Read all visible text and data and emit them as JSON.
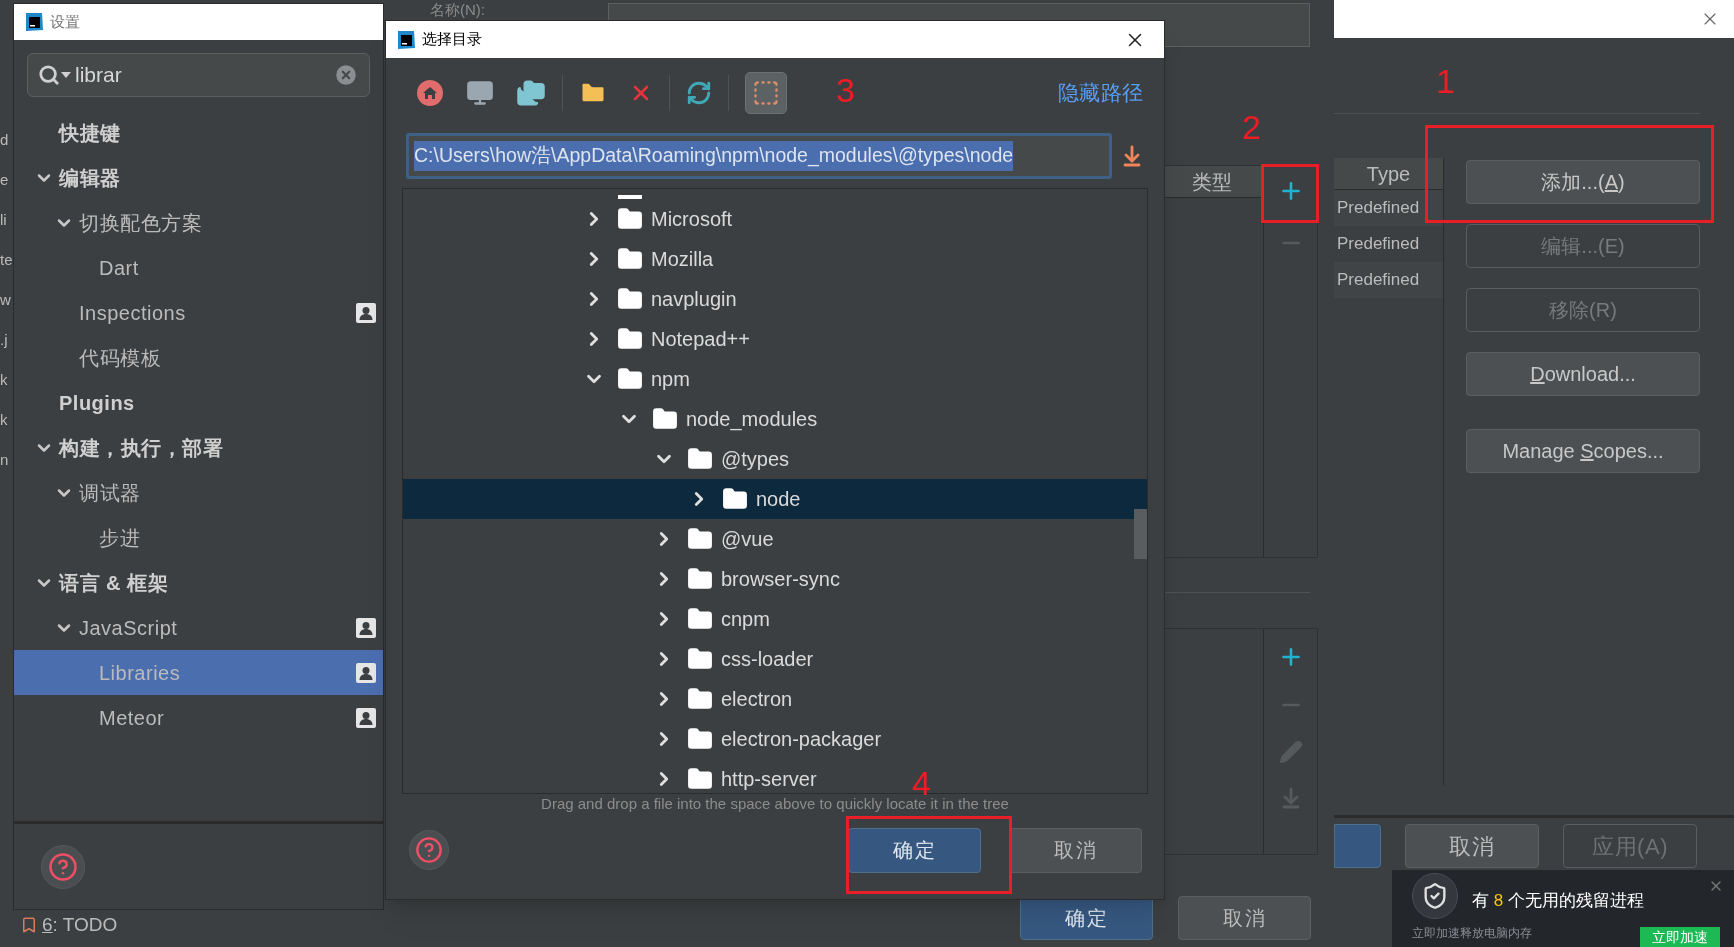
{
  "ide_background": {
    "editor_fragments": [
      "d",
      "e",
      "li",
      "te",
      "w",
      ".j",
      "k",
      "k",
      "n"
    ],
    "tool_window_tab": {
      "number": "6",
      "label": ": TODO"
    }
  },
  "settings_window": {
    "title": "设置",
    "search": {
      "value": "librar"
    },
    "tree": [
      {
        "label": "快捷键",
        "selected": false,
        "badge": false
      },
      {
        "label": "编辑器",
        "expanded": true,
        "selected": false,
        "badge": false,
        "children": [
          {
            "label": "切换配色方案",
            "expanded": true,
            "selected": false,
            "badge": false,
            "children": [
              {
                "label": "Dart",
                "selected": false,
                "badge": false
              }
            ]
          },
          {
            "label": "Inspections",
            "selected": false,
            "badge": true
          },
          {
            "label": "代码模板",
            "selected": false,
            "badge": false
          }
        ]
      },
      {
        "label": "Plugins",
        "selected": false,
        "badge": false
      },
      {
        "label": "构建，执行，部署",
        "expanded": true,
        "selected": false,
        "badge": false,
        "children": [
          {
            "label": "调试器",
            "expanded": true,
            "selected": false,
            "badge": false,
            "children": [
              {
                "label": "步进",
                "selected": false,
                "badge": false
              }
            ]
          }
        ]
      },
      {
        "label": "语言 & 框架",
        "expanded": true,
        "selected": false,
        "badge": false,
        "children": [
          {
            "label": "JavaScript",
            "expanded": true,
            "selected": false,
            "badge": true,
            "children": [
              {
                "label": "Libraries",
                "selected": true,
                "badge": true
              },
              {
                "label": "Meteor",
                "selected": false,
                "badge": true
              }
            ]
          }
        ]
      }
    ]
  },
  "library_dialog": {
    "name_label": "名称(N):",
    "table": {
      "column": "类型"
    },
    "buttons": [
      {
        "label": "确定",
        "primary": true
      },
      {
        "label": "取消",
        "primary": false
      }
    ]
  },
  "libraries_dialog": {
    "table": {
      "column": "Type",
      "rows": [
        "Predefined",
        "Predefined",
        "Predefined"
      ]
    },
    "side_buttons": [
      {
        "before": "添加...(",
        "mnemonic": "A",
        "after": ")",
        "disabled": false
      },
      {
        "label": "编辑...(E)",
        "disabled": true
      },
      {
        "label": "移除(R)",
        "disabled": true
      },
      {
        "mnemonic": "D",
        "after": "ownload...",
        "disabled": false
      },
      {
        "before": "Manage ",
        "mnemonic": "S",
        "after": "copes...",
        "disabled": false
      }
    ],
    "buttons": [
      {
        "label": "取消",
        "disabled": false
      },
      {
        "label": "应用(A)",
        "disabled": true
      }
    ]
  },
  "choose_directory_dialog": {
    "title": "选择目录",
    "toggle_path_label": "隐藏路径",
    "path": {
      "value": "C:\\Users\\how浩\\AppData\\Roaming\\npm\\node_modules\\@types\\node",
      "selected": true
    },
    "tree": [
      {
        "label": "Microsoft",
        "expanded": false,
        "selected": false
      },
      {
        "label": "Mozilla",
        "expanded": false,
        "selected": false
      },
      {
        "label": "navplugin",
        "expanded": false,
        "selected": false
      },
      {
        "label": "Notepad++",
        "expanded": false,
        "selected": false
      },
      {
        "label": "npm",
        "expanded": true,
        "selected": false,
        "children": [
          {
            "label": "node_modules",
            "expanded": true,
            "selected": false,
            "children": [
              {
                "label": "@types",
                "expanded": true,
                "selected": false,
                "children": [
                  {
                    "label": "node",
                    "expanded": false,
                    "selected": true
                  }
                ]
              },
              {
                "label": "@vue",
                "expanded": false,
                "selected": false
              },
              {
                "label": "browser-sync",
                "expanded": false,
                "selected": false
              },
              {
                "label": "cnpm",
                "expanded": false,
                "selected": false
              },
              {
                "label": "css-loader",
                "expanded": false,
                "selected": false
              },
              {
                "label": "electron",
                "expanded": false,
                "selected": false
              },
              {
                "label": "electron-packager",
                "expanded": false,
                "selected": false
              },
              {
                "label": "http-server",
                "expanded": false,
                "selected": false
              }
            ]
          }
        ]
      }
    ],
    "hint": "Drag and drop a file into the space above to quickly locate it in the tree",
    "buttons": [
      {
        "label": "确定",
        "primary": true
      },
      {
        "label": "取消",
        "primary": false
      }
    ]
  },
  "annotations": [
    "1",
    "2",
    "3",
    "4"
  ],
  "notification": {
    "before": "有 ",
    "count": "8",
    "after": " 个无用的残留进程",
    "subtitle": "立即加速释放电脑内存",
    "action": "立即加速"
  }
}
